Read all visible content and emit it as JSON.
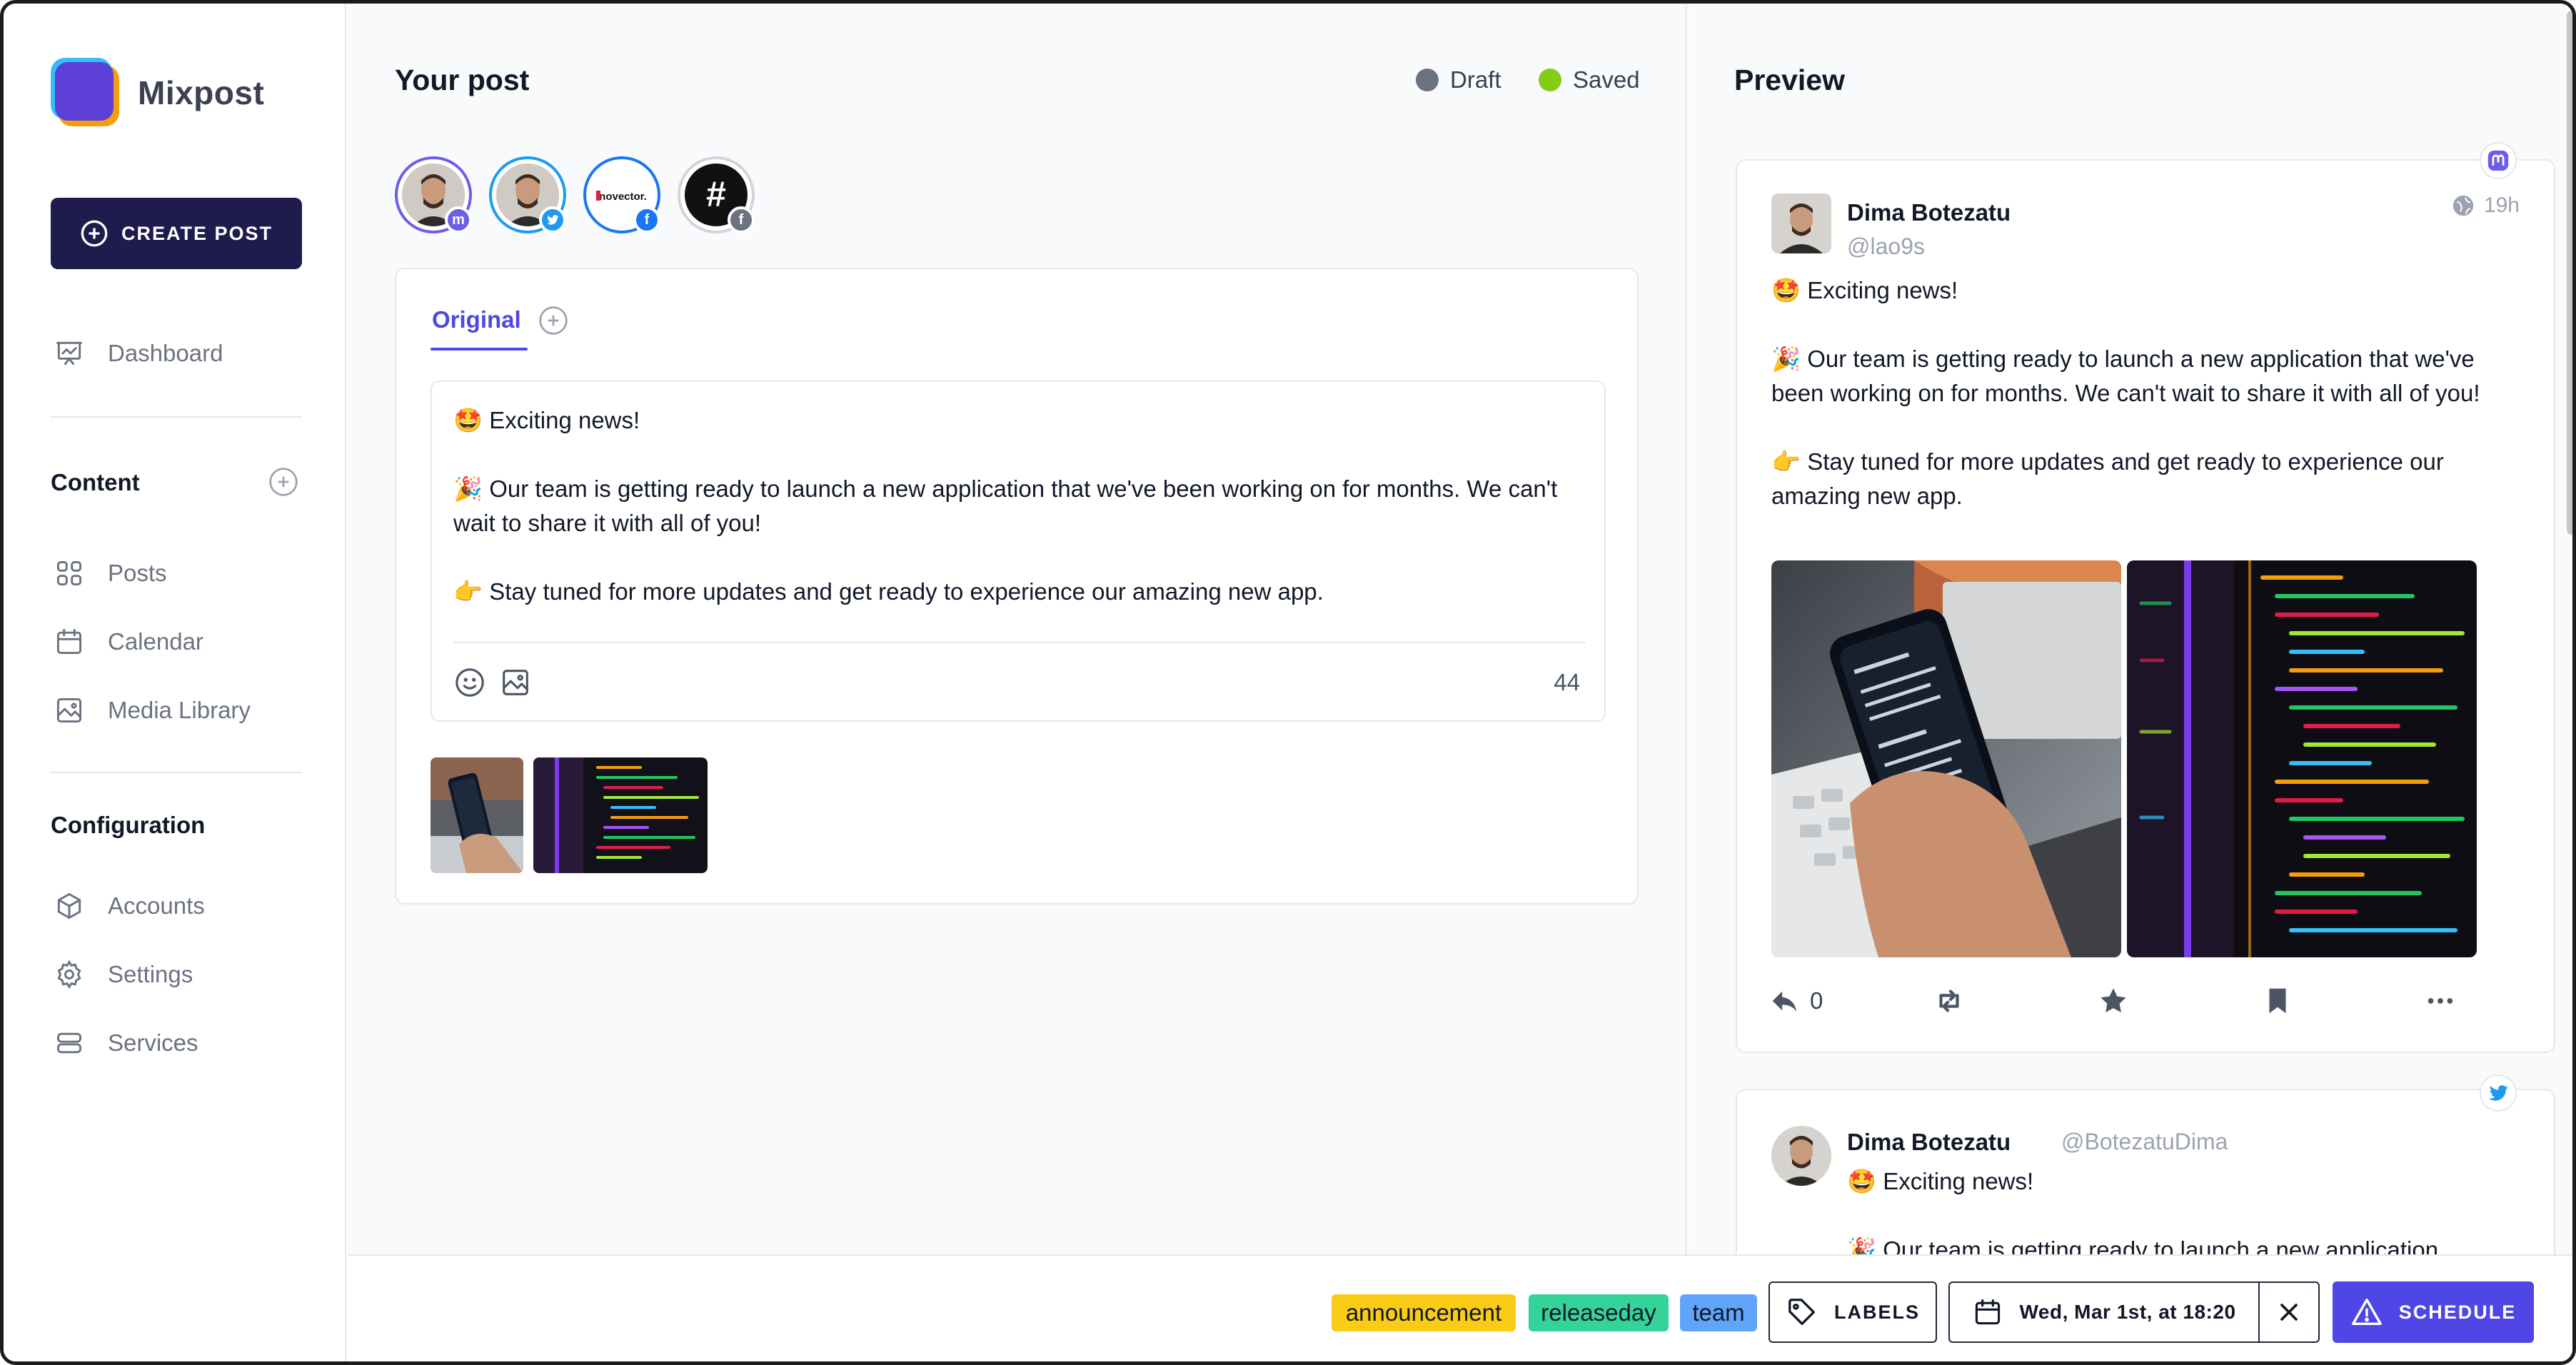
{
  "app": {
    "name": "Mixpost"
  },
  "sidebar": {
    "create_post_label": "CREATE POST",
    "dashboard_label": "Dashboard",
    "content_title": "Content",
    "content_items": [
      {
        "label": "Posts",
        "icon": "grid-icon"
      },
      {
        "label": "Calendar",
        "icon": "calendar-icon"
      },
      {
        "label": "Media Library",
        "icon": "image-icon"
      }
    ],
    "configuration_title": "Configuration",
    "config_items": [
      {
        "label": "Accounts",
        "icon": "cube-icon"
      },
      {
        "label": "Settings",
        "icon": "gear-icon"
      },
      {
        "label": "Services",
        "icon": "stack-icon"
      }
    ]
  },
  "editor": {
    "title": "Your post",
    "status_draft": "Draft",
    "status_saved": "Saved",
    "status_colors": {
      "draft": "#6b7280",
      "saved": "#84cc16"
    },
    "accounts": [
      {
        "network": "mastodon",
        "badge_color": "#6d5ee8",
        "badge_icon": "mastodon-icon",
        "avatar": "user-photo"
      },
      {
        "network": "twitter",
        "badge_color": "#1d9bf0",
        "badge_icon": "twitter-icon",
        "avatar": "user-photo"
      },
      {
        "network": "facebook",
        "badge_color": "#1877f2",
        "badge_icon": "facebook-icon",
        "avatar": "inovector-logo",
        "avatar_text": "inovector."
      },
      {
        "network": "facebook",
        "badge_color": "#6b7280",
        "badge_icon": "facebook-icon",
        "avatar": "hashtag-logo",
        "avatar_text": "#"
      }
    ],
    "tab_original": "Original",
    "body": {
      "line1": "🤩 Exciting news!",
      "line2": "🎉 Our team is getting ready to launch a new application that we've been working on for months. We can't wait to share it with all of you!",
      "line3": "👉 Stay tuned for more updates and get ready to experience our amazing new app."
    },
    "char_count": "44",
    "media": [
      "phone-photo",
      "code-photo"
    ]
  },
  "preview": {
    "title": "Preview",
    "mastodon": {
      "name": "Dima Botezatu",
      "handle": "@lao9s",
      "time": "19h",
      "reply_count": "0",
      "line1": "🤩 Exciting news!",
      "line2": "🎉 Our team is getting ready to launch a new application that we've been working on for months. We can't wait to share it with all of you!",
      "line3": "👉 Stay tuned for more updates and get ready to experience our amazing new app."
    },
    "twitter": {
      "name": "Dima Botezatu",
      "handle": "@BotezatuDima",
      "line1": "🤩 Exciting news!",
      "line2": "🎉 Our team is getting ready to launch a new application"
    }
  },
  "footer": {
    "labels": [
      {
        "text": "announcement",
        "color": "#facc15"
      },
      {
        "text": "releaseday",
        "color": "#34d399"
      },
      {
        "text": "team",
        "color": "#60a5fa"
      }
    ],
    "labels_button": "LABELS",
    "date": "Wed, Mar 1st, at 18:20",
    "schedule_button": "SCHEDULE"
  }
}
